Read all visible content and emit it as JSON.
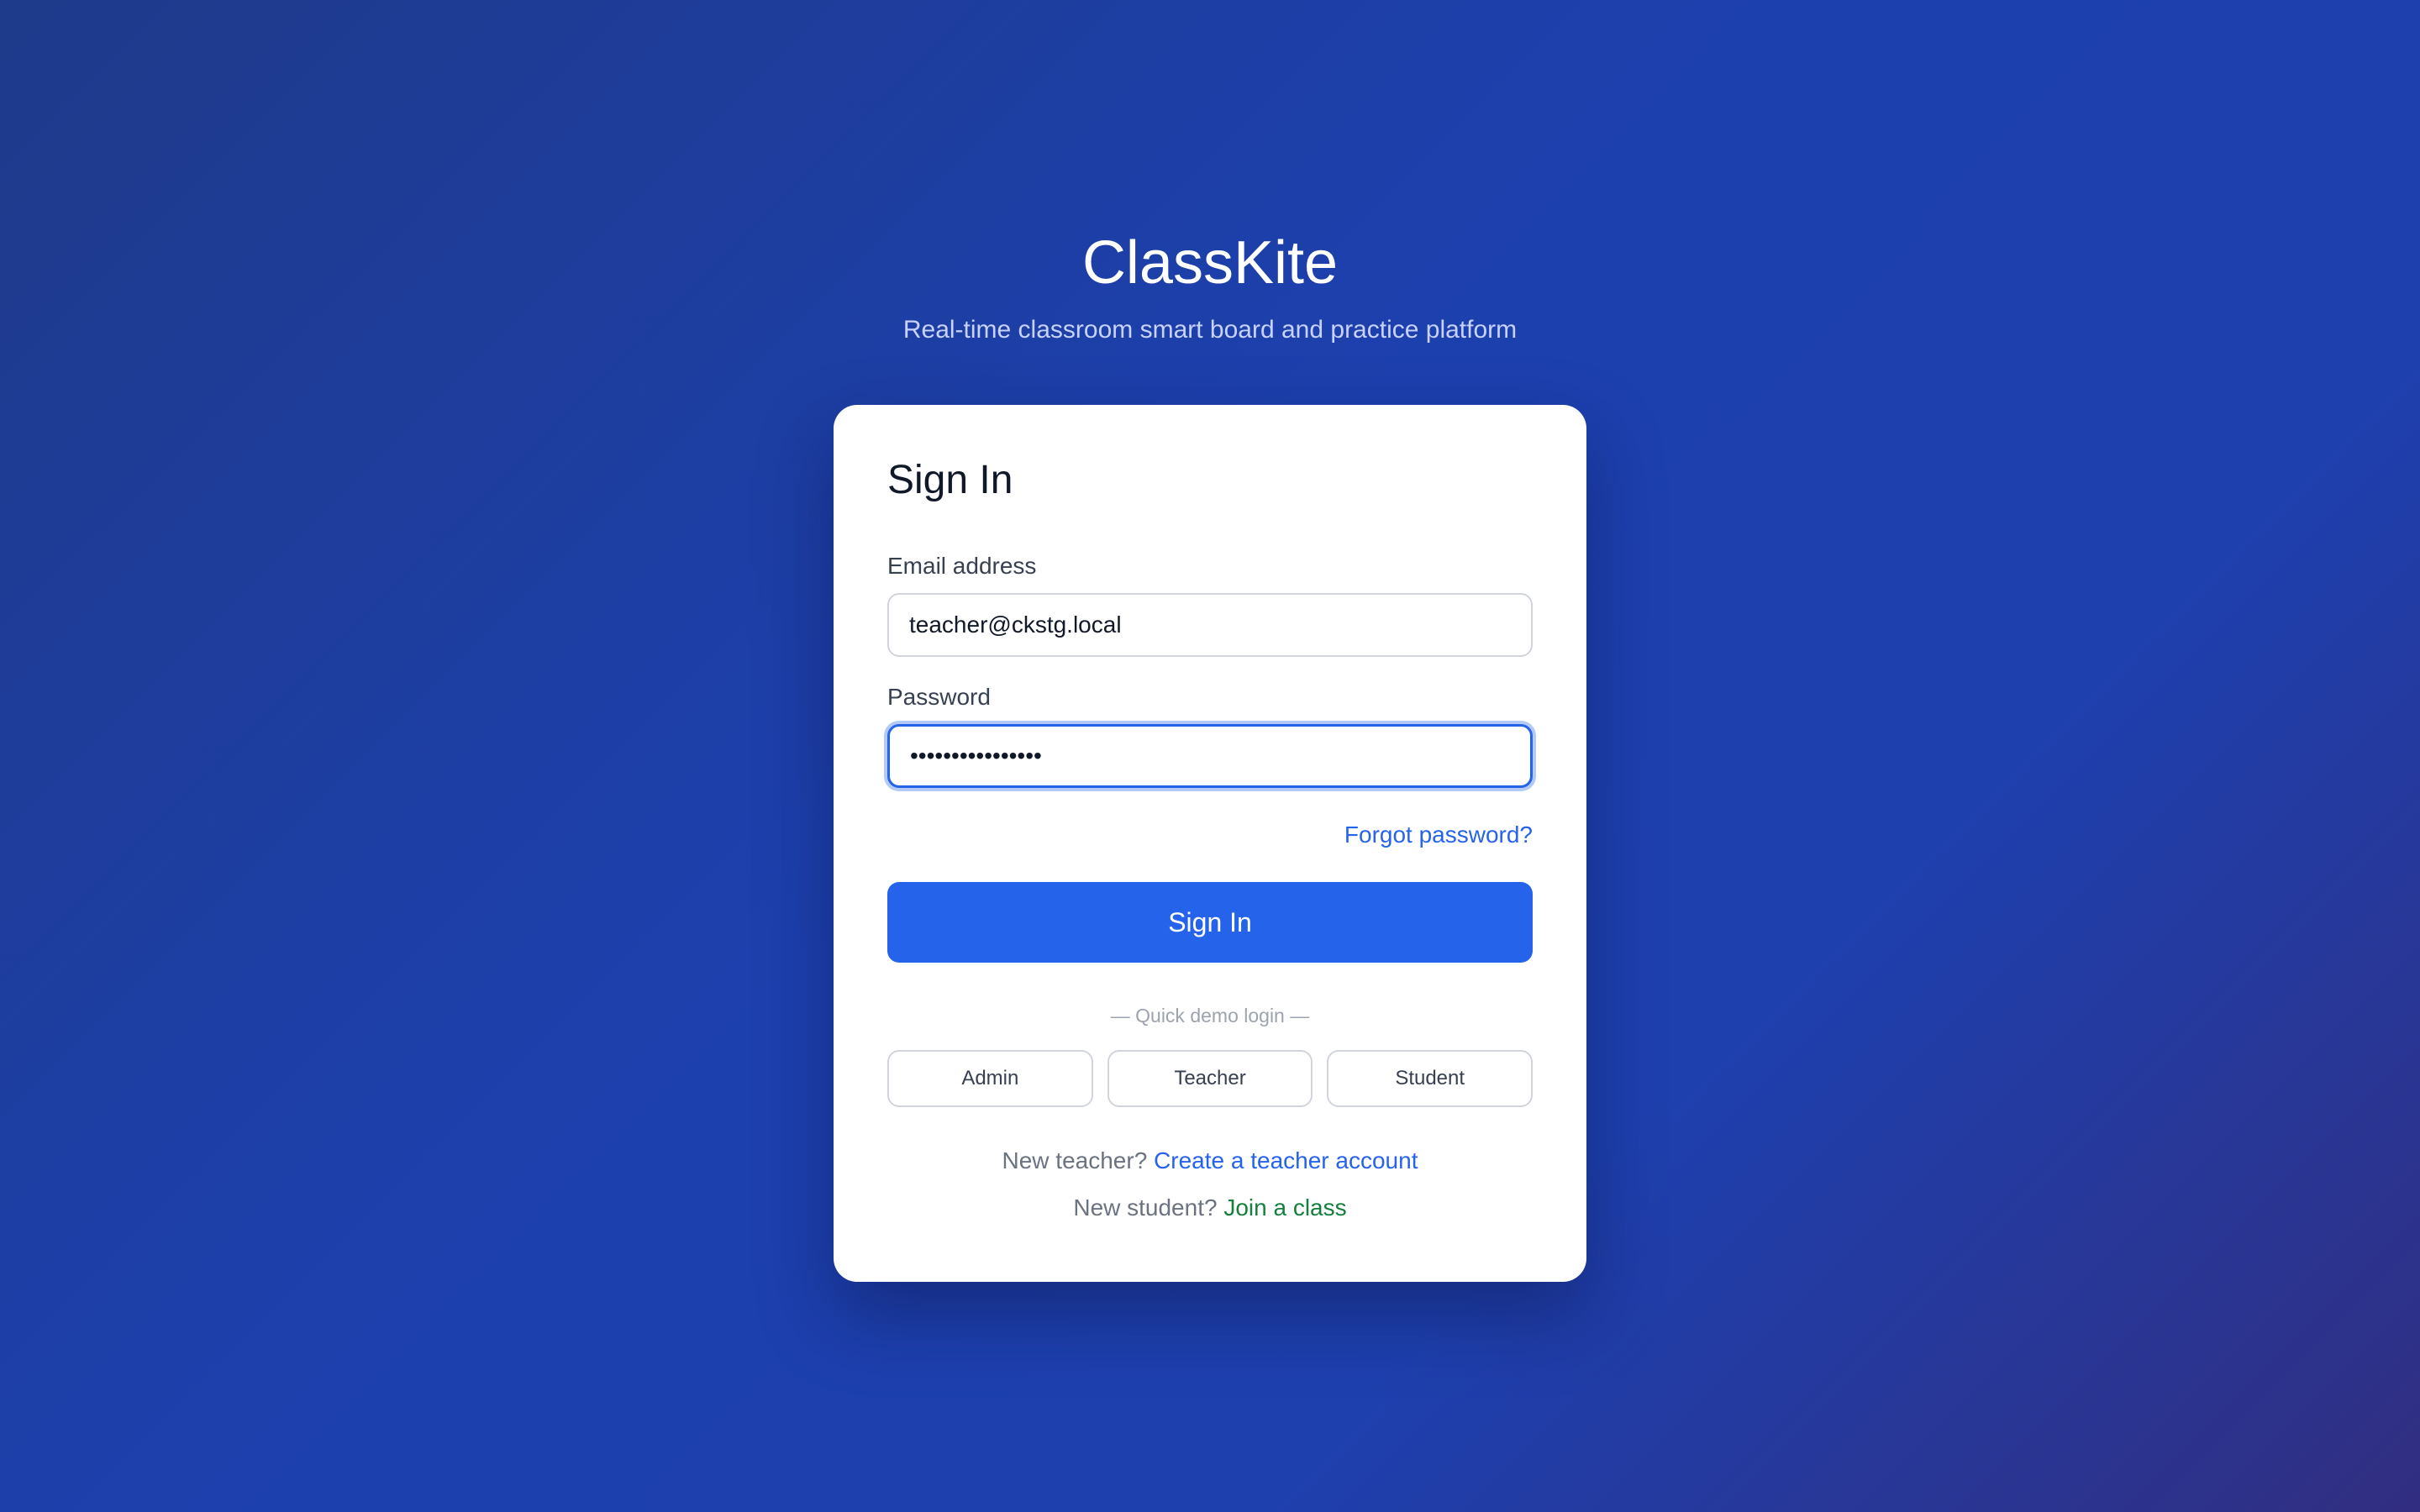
{
  "brand": {
    "title": "ClassKite",
    "subtitle": "Real-time classroom smart board and practice platform"
  },
  "signin_form": {
    "heading": "Sign In",
    "email_label": "Email address",
    "email_value": "teacher@ckstg.local",
    "password_label": "Password",
    "password_value": "••••••••••••••••",
    "forgot_password_label": "Forgot password?",
    "submit_label": "Sign In"
  },
  "quick_demo": {
    "divider_label": "— Quick demo login —",
    "buttons": [
      {
        "label": "Admin"
      },
      {
        "label": "Teacher"
      },
      {
        "label": "Student"
      }
    ]
  },
  "footer": {
    "teacher_prompt": "New teacher?",
    "teacher_link": "Create a teacher account",
    "student_prompt": "New student?",
    "student_link": "Join a class"
  },
  "colors": {
    "accent": "#2563eb",
    "student_link": "#15803d",
    "background_start": "#1e3a8a",
    "background_end": "#312e81"
  }
}
